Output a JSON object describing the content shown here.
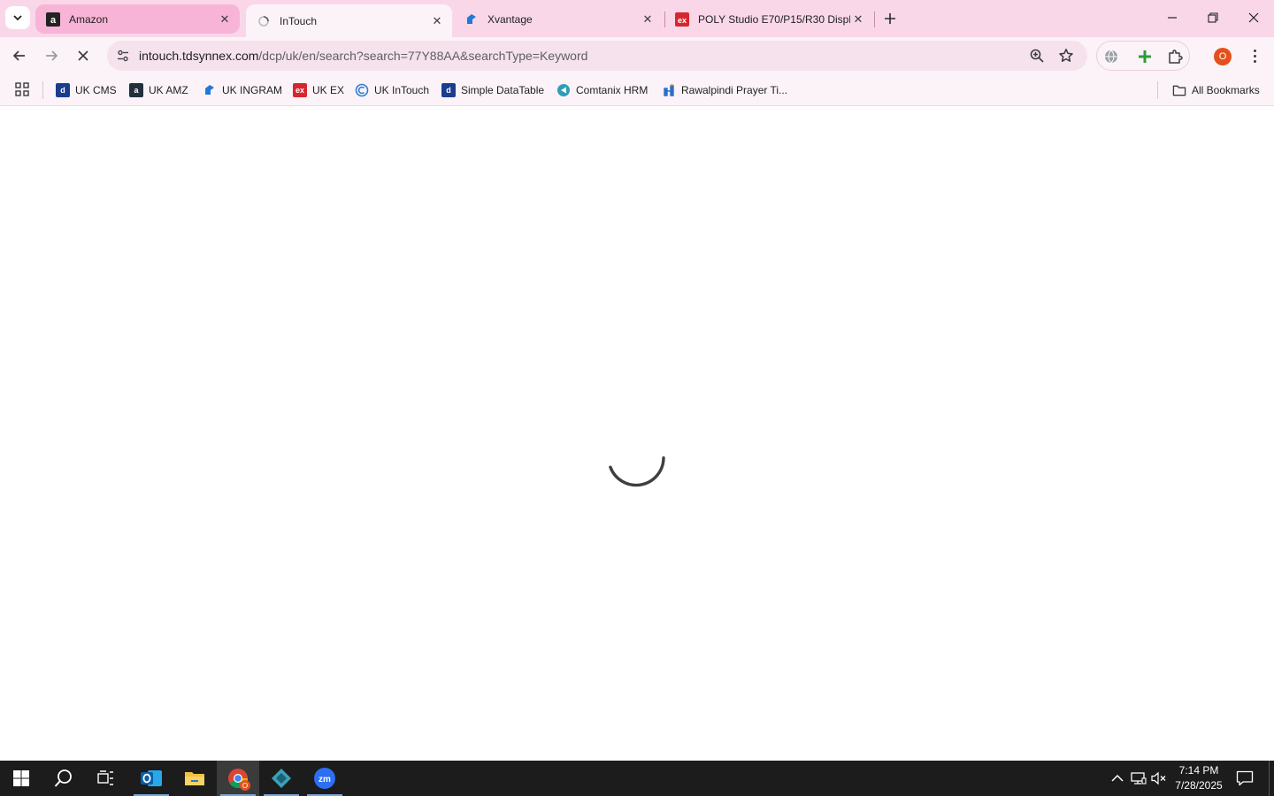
{
  "browser": {
    "tabs": [
      {
        "title": "Amazon",
        "favicon": "amazon-icon"
      },
      {
        "title": "InTouch",
        "favicon": "loading-icon",
        "active": true
      },
      {
        "title": "Xvantage",
        "favicon": "xvantage-icon"
      },
      {
        "title": "POLY Studio E70/P15/R30 Displ",
        "favicon": "ex-icon"
      }
    ],
    "address": {
      "domain": "intouch.tdsynnex.com",
      "path": "/dcp/uk/en/search?search=77Y88AA&searchType=Keyword"
    },
    "profile_initial": "O",
    "bookmarks": [
      {
        "label": "UK CMS",
        "favicon": "td-icon",
        "color": "#1a3d8f"
      },
      {
        "label": "UK AMZ",
        "favicon": "amazon-icon",
        "color": "#232f3e"
      },
      {
        "label": "UK INGRAM",
        "favicon": "xvantage-icon",
        "color": "#1f7bd6"
      },
      {
        "label": "UK EX",
        "favicon": "ex-icon",
        "color": "#d8262f"
      },
      {
        "label": "UK InTouch",
        "favicon": "intouch-icon",
        "color": "#2a7fd4"
      },
      {
        "label": "Simple DataTable",
        "favicon": "td-icon",
        "color": "#1a3d8f"
      },
      {
        "label": "Comtanix HRM",
        "favicon": "comtanix-icon",
        "color": "#2c9fb5"
      },
      {
        "label": "Rawalpindi Prayer Ti...",
        "favicon": "prayer-icon",
        "color": "#2c6ec9"
      }
    ],
    "all_bookmarks_label": "All Bookmarks"
  },
  "taskbar": {
    "time": "7:14 PM",
    "date": "7/28/2025",
    "chrome_badge": "O"
  },
  "colors": {
    "tabstrip": "#f9d7e9",
    "toolbar": "#fbf3f8",
    "taskbar": "#1c1c1c"
  }
}
